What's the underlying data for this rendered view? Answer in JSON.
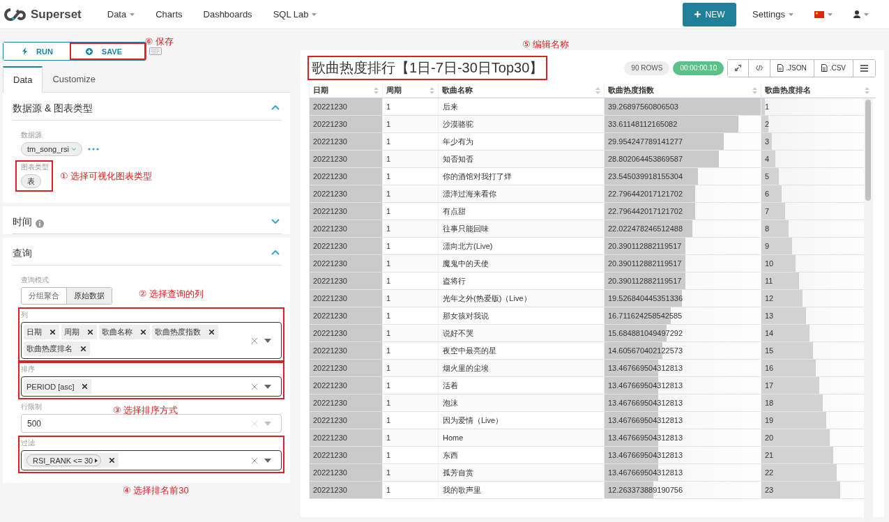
{
  "navbar": {
    "brand": "Superset",
    "menu": [
      {
        "label": "Data",
        "dropdown": true
      },
      {
        "label": "Charts",
        "dropdown": false
      },
      {
        "label": "Dashboards",
        "dropdown": false
      },
      {
        "label": "SQL Lab",
        "dropdown": true
      }
    ],
    "new_button": "NEW",
    "settings": "Settings"
  },
  "toolbar": [
    {
      "kind": "run",
      "label": "RUN",
      "highlighted": false
    },
    {
      "kind": "save",
      "label": "SAVE",
      "highlighted": true,
      "annotation": "⑥ 保存"
    }
  ],
  "tabs": [
    {
      "label": "Data",
      "selected": true
    },
    {
      "label": "Customize",
      "selected": false
    }
  ],
  "sections": [
    {
      "title": "数据源 & 图表类型",
      "expanded": true,
      "info": false,
      "controls": [
        {
          "kind": "datasource",
          "label": "数据源",
          "value": "tm_song_rsi",
          "highlighted": false
        },
        {
          "kind": "charttype",
          "label": "图表类型",
          "value": "表",
          "highlighted": true,
          "annotation": "① 选择可视化图表类型"
        }
      ]
    },
    {
      "title": "时间",
      "expanded": false,
      "info": true
    },
    {
      "title": "查询",
      "expanded": true,
      "info": false,
      "controls": [
        {
          "kind": "segmented",
          "label": "查询模式",
          "highlighted": false,
          "options": [
            {
              "label": "分组聚合",
              "selected": false
            },
            {
              "label": "原始数据",
              "selected": true
            }
          ]
        },
        {
          "kind": "multiselect",
          "label": "列",
          "highlighted": true,
          "annotation": "② 选择查询的列",
          "tags": [
            "日期",
            "周期",
            "歌曲名称",
            "歌曲热度指数",
            "歌曲热度排名"
          ]
        },
        {
          "kind": "multiselect",
          "label": "排序",
          "highlighted": true,
          "annotation": "③ 选择排序方式",
          "tags": [
            "PERIOD [asc]"
          ]
        },
        {
          "kind": "select",
          "label": "行限制",
          "value": "500",
          "highlighted": false
        },
        {
          "kind": "filter",
          "label": "过滤",
          "highlighted": true,
          "annotation": "④ 选择排名前30",
          "tags": [
            "RSI_RANK <= 30"
          ]
        }
      ]
    }
  ],
  "chart": {
    "title": "歌曲热度排行【1日-7日-30日Top30】",
    "title_highlighted": true,
    "title_annotation": "⑤ 编辑名称",
    "row_count": "90 ROWS",
    "duration": "00:00:00.10",
    "actions": [
      {
        "kind": "link"
      },
      {
        "kind": "code"
      },
      {
        "kind": "json",
        "label": ".JSON"
      },
      {
        "kind": "csv",
        "label": ".CSV"
      },
      {
        "kind": "menu"
      }
    ],
    "table": {
      "columns": [
        "日期",
        "周期",
        "歌曲名称",
        "歌曲热度指数",
        "歌曲热度排名"
      ],
      "rows": [
        {
          "cells": [
            {
              "text": "20221230",
              "level": 1
            },
            {
              "text": "1"
            },
            {
              "text": "后来"
            },
            {
              "text": "39.26897560806503",
              "level": 1
            },
            {
              "text": "1",
              "level": 0.033
            }
          ]
        },
        {
          "cells": [
            {
              "text": "20221230",
              "level": 1
            },
            {
              "text": "1"
            },
            {
              "text": "沙漠骆驼"
            },
            {
              "text": "33.61148112165082",
              "level": 0.856
            },
            {
              "text": "2",
              "level": 0.067
            }
          ]
        },
        {
          "cells": [
            {
              "text": "20221230",
              "level": 1
            },
            {
              "text": "1"
            },
            {
              "text": "年少有为"
            },
            {
              "text": "29.954247789141277",
              "level": 0.763
            },
            {
              "text": "3",
              "level": 0.1
            }
          ]
        },
        {
          "cells": [
            {
              "text": "20221230",
              "level": 1
            },
            {
              "text": "1"
            },
            {
              "text": "知否知否"
            },
            {
              "text": "28.802064453869587",
              "level": 0.733
            },
            {
              "text": "4",
              "level": 0.133
            }
          ]
        },
        {
          "cells": [
            {
              "text": "20221230",
              "level": 1
            },
            {
              "text": "1"
            },
            {
              "text": "你的酒馆对我打了烊"
            },
            {
              "text": "23.545039918155304",
              "level": 0.6
            },
            {
              "text": "5",
              "level": 0.167
            }
          ]
        },
        {
          "cells": [
            {
              "text": "20221230",
              "level": 1
            },
            {
              "text": "1"
            },
            {
              "text": "漂洋过海来看你"
            },
            {
              "text": "22.796442017121702",
              "level": 0.581
            },
            {
              "text": "6",
              "level": 0.2
            }
          ]
        },
        {
          "cells": [
            {
              "text": "20221230",
              "level": 1
            },
            {
              "text": "1"
            },
            {
              "text": "有点甜"
            },
            {
              "text": "22.796442017121702",
              "level": 0.581
            },
            {
              "text": "7",
              "level": 0.233
            }
          ]
        },
        {
          "cells": [
            {
              "text": "20221230",
              "level": 1
            },
            {
              "text": "1"
            },
            {
              "text": "往事只能回味"
            },
            {
              "text": "22.022478246512488",
              "level": 0.561
            },
            {
              "text": "8",
              "level": 0.267
            }
          ]
        },
        {
          "cells": [
            {
              "text": "20221230",
              "level": 1
            },
            {
              "text": "1"
            },
            {
              "text": "漂向北方(Live)"
            },
            {
              "text": "20.390112882119517",
              "level": 0.519
            },
            {
              "text": "9",
              "level": 0.3
            }
          ]
        },
        {
          "cells": [
            {
              "text": "20221230",
              "level": 1
            },
            {
              "text": "1"
            },
            {
              "text": "魔鬼中的天使"
            },
            {
              "text": "20.390112882119517",
              "level": 0.519
            },
            {
              "text": "10",
              "level": 0.333
            }
          ]
        },
        {
          "cells": [
            {
              "text": "20221230",
              "level": 1
            },
            {
              "text": "1"
            },
            {
              "text": "盗将行"
            },
            {
              "text": "20.390112882119517",
              "level": 0.519
            },
            {
              "text": "11",
              "level": 0.367
            }
          ]
        },
        {
          "cells": [
            {
              "text": "20221230",
              "level": 1
            },
            {
              "text": "1"
            },
            {
              "text": "光年之外(热爱版)（Live）"
            },
            {
              "text": "19.526840445351336",
              "level": 0.497
            },
            {
              "text": "12",
              "level": 0.4
            }
          ]
        },
        {
          "cells": [
            {
              "text": "20221230",
              "level": 1
            },
            {
              "text": "1"
            },
            {
              "text": "那女孩对我说"
            },
            {
              "text": "16.711624258542585",
              "level": 0.426
            },
            {
              "text": "13",
              "level": 0.433
            }
          ]
        },
        {
          "cells": [
            {
              "text": "20221230",
              "level": 1
            },
            {
              "text": "1"
            },
            {
              "text": "说好不哭"
            },
            {
              "text": "15.684881049497292",
              "level": 0.399
            },
            {
              "text": "14",
              "level": 0.467
            }
          ]
        },
        {
          "cells": [
            {
              "text": "20221230",
              "level": 1
            },
            {
              "text": "1"
            },
            {
              "text": "夜空中最亮的星"
            },
            {
              "text": "14.605670402122573",
              "level": 0.372
            },
            {
              "text": "15",
              "level": 0.5
            }
          ]
        },
        {
          "cells": [
            {
              "text": "20221230",
              "level": 1
            },
            {
              "text": "1"
            },
            {
              "text": "烟火里的尘埃"
            },
            {
              "text": "13.467669504312813",
              "level": 0.343
            },
            {
              "text": "16",
              "level": 0.533
            }
          ]
        },
        {
          "cells": [
            {
              "text": "20221230",
              "level": 1
            },
            {
              "text": "1"
            },
            {
              "text": "活着"
            },
            {
              "text": "13.467669504312813",
              "level": 0.343
            },
            {
              "text": "17",
              "level": 0.567
            }
          ]
        },
        {
          "cells": [
            {
              "text": "20221230",
              "level": 1
            },
            {
              "text": "1"
            },
            {
              "text": "泡沫"
            },
            {
              "text": "13.467669504312813",
              "level": 0.343
            },
            {
              "text": "18",
              "level": 0.6
            }
          ]
        },
        {
          "cells": [
            {
              "text": "20221230",
              "level": 1
            },
            {
              "text": "1"
            },
            {
              "text": "因为爱情（Live）"
            },
            {
              "text": "13.467669504312813",
              "level": 0.343
            },
            {
              "text": "19",
              "level": 0.633
            }
          ]
        },
        {
          "cells": [
            {
              "text": "20221230",
              "level": 1
            },
            {
              "text": "1"
            },
            {
              "text": "Home"
            },
            {
              "text": "13.467669504312813",
              "level": 0.343
            },
            {
              "text": "20",
              "level": 0.667
            }
          ]
        },
        {
          "cells": [
            {
              "text": "20221230",
              "level": 1
            },
            {
              "text": "1"
            },
            {
              "text": "东西"
            },
            {
              "text": "13.467669504312813",
              "level": 0.343
            },
            {
              "text": "21",
              "level": 0.7
            }
          ]
        },
        {
          "cells": [
            {
              "text": "20221230",
              "level": 1
            },
            {
              "text": "1"
            },
            {
              "text": "孤芳自赏"
            },
            {
              "text": "13.467669504312813",
              "level": 0.343
            },
            {
              "text": "22",
              "level": 0.733
            }
          ]
        },
        {
          "cells": [
            {
              "text": "20221230",
              "level": 1
            },
            {
              "text": "1"
            },
            {
              "text": "我的歌声里"
            },
            {
              "text": "12.263373889190756",
              "level": 0.312
            },
            {
              "text": "23",
              "level": 0.767
            }
          ]
        }
      ]
    }
  }
}
